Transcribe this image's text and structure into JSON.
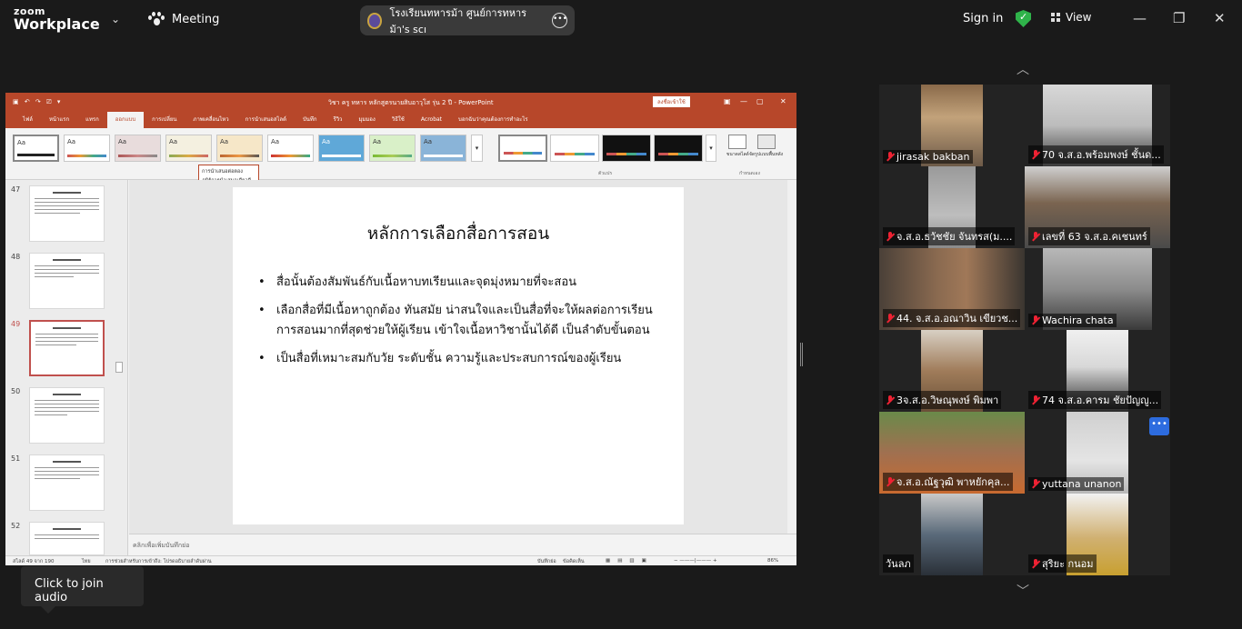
{
  "zoom": {
    "logo_top": "zoom",
    "logo_bottom": "Workplace",
    "meeting_label": "Meeting",
    "meeting_name": "โรงเรียนทหารม้า ศูนย์การทหารม้า's scı",
    "sign_in": "Sign in",
    "view": "View",
    "join_audio_tip": "Click to join audio",
    "security_color": "#2fb34a",
    "accent": "#2d6cdf"
  },
  "powerpoint": {
    "window_title": "วิชา ครู ทหาร  หลักสูตรนายสิบอาวุโส รุ่น 2 ปี  -  PowerPoint",
    "sign_in_button": "ลงชื่อเข้าใช้",
    "tabs": [
      "ไฟล์",
      "หน้าแรก",
      "แทรก",
      "ออกแบบ",
      "การเปลี่ยน",
      "ภาพเคลื่อนไหว",
      "การนำเสนอสไลด์",
      "บันทึก",
      "รีวิว",
      "มุมมอง",
      "วิธีใช้",
      "Acrobat",
      "บอกฉันว่าคุณต้องการทำอะไร"
    ],
    "active_tab": "ออกแบบ",
    "theme_label": "Aa",
    "variants_label": "ตัวแปร",
    "customize_label": "กำหนดเอง",
    "slide_size_label": "ขนาดสไลด์",
    "format_bg_label": "จัดรูปแบบพื้นหลัง",
    "tooltip_line1": "การนำเสนอต่อตอง",
    "tooltip_line2": "ภูมิรู้การนำเสนอเดียวดี",
    "thumbnails": [
      {
        "num": "47"
      },
      {
        "num": "48"
      },
      {
        "num": "49"
      },
      {
        "num": "50"
      },
      {
        "num": "51"
      },
      {
        "num": "52"
      }
    ],
    "slide_title": "หลักการเลือกสื่อการสอน",
    "bullets": [
      "สื่อนั้นต้องสัมพันธ์กับเนื้อหาบทเรียนและจุดมุ่งหมายที่จะสอน",
      "เลือกสื่อที่มีเนื้อหาถูกต้อง ทันสมัย น่าสนใจและเป็นสื่อที่จะให้ผลต่อการเรียนการสอนมากที่สุดช่วยให้ผู้เรียน เข้าใจเนื้อหาวิชานั้นได้ดี เป็นลำดับขั้นตอน",
      "เป็นสื่อที่เหมาะสมกับวัย ระดับชั้น ความรู้และประสบการณ์ของผู้เรียน"
    ],
    "notes_placeholder": "คลิกเพื่อเพิ่มบันทึกย่อ",
    "status_slide": "สไลด์ 49 จาก 190",
    "status_lang": "ไทย",
    "status_access": "การช่วยสำหรับการเข้าถึง: โปรดอธิบายลำดับผ่าน",
    "status_notes": "บันทึกย่อ",
    "status_comments": "ข้อคิดเห็น",
    "status_zoom": "86%",
    "brand_color": "#b7472a"
  },
  "participants": [
    {
      "name": "jirasak bakban",
      "muted": true
    },
    {
      "name": "70 จ.ส.อ.พร้อมพงษ์ ชั้นด...",
      "muted": true
    },
    {
      "name": "จ.ส.อ.ธวัชชัย จันทรส(ม....",
      "muted": true
    },
    {
      "name": "เลขที่ 63 จ.ส.อ.คเชนทร์",
      "muted": true
    },
    {
      "name": "44. จ.ส.อ.อณาวิน เขียวช...",
      "muted": true
    },
    {
      "name": "Wachira chata",
      "muted": true
    },
    {
      "name": "3จ.ส.อ.วิษณุพงษ์ พิมพา",
      "muted": true
    },
    {
      "name": "74 จ.ส.อ.คารม ชัยปัญญู...",
      "muted": true
    },
    {
      "name": "จ.ส.อ.ณัฐวุฒิ พาหยักคุล...",
      "muted": true
    },
    {
      "name": "yuttana unanon",
      "muted": true
    },
    {
      "name": "วันลภ",
      "muted": false
    },
    {
      "name": "สุริยะ กนอม",
      "muted": true
    }
  ]
}
